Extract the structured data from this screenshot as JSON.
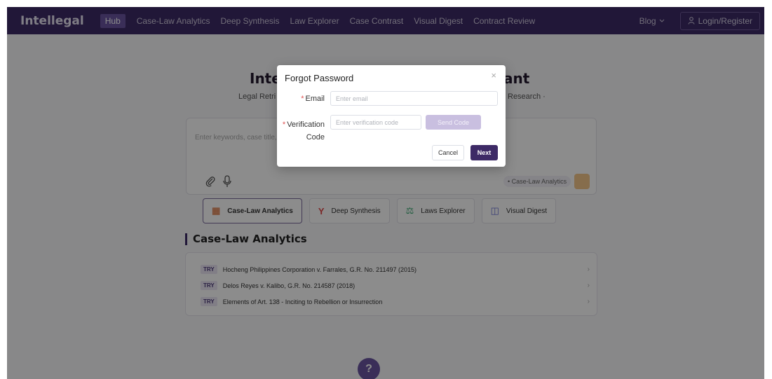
{
  "nav": {
    "brand": "Intellegal",
    "items": [
      "Hub",
      "Case-Law Analytics",
      "Deep Synthesis",
      "Law Explorer",
      "Case Contrast",
      "Visual Digest",
      "Contract Review"
    ],
    "blog": "Blog",
    "login": "Login/Register"
  },
  "hero": {
    "title_left": "Inte",
    "title_right": "ant",
    "subtitle_left": "Legal Retri",
    "subtitle_right": "Research ·"
  },
  "search": {
    "placeholder": "Enter keywords, case title, t",
    "mode_chip": "• Case-Law Analytics"
  },
  "mode_tabs": [
    {
      "label": "Case-Law Analytics",
      "icon": "document-search-icon"
    },
    {
      "label": "Deep Synthesis",
      "icon": "fork-icon"
    },
    {
      "label": "Laws Explorer",
      "icon": "scales-icon"
    },
    {
      "label": "Visual Digest",
      "icon": "visual-icon"
    }
  ],
  "section": {
    "heading": "Case-Law Analytics",
    "try_badge": "TRY",
    "items": [
      "Hocheng Philippines Corporation v. Farrales, G.R. No. 211497 (2015)",
      "Delos Reyes v. Kalibo, G.R. No. 214587 (2018)",
      "Elements of Art. 138 - Inciting to Rebellion or Insurrection"
    ]
  },
  "help": "?",
  "modal": {
    "title": "Forgot Password",
    "email_label": "Email",
    "email_placeholder": "Enter email",
    "code_label_1": "Verification",
    "code_label_2": "Code",
    "code_placeholder": "Enter verification code",
    "send_code": "Send Code",
    "cancel": "Cancel",
    "next": "Next",
    "close": "×"
  },
  "colors": {
    "nav_bg": "#3d2a66",
    "primary": "#3d2a66",
    "required": "#e05252"
  }
}
